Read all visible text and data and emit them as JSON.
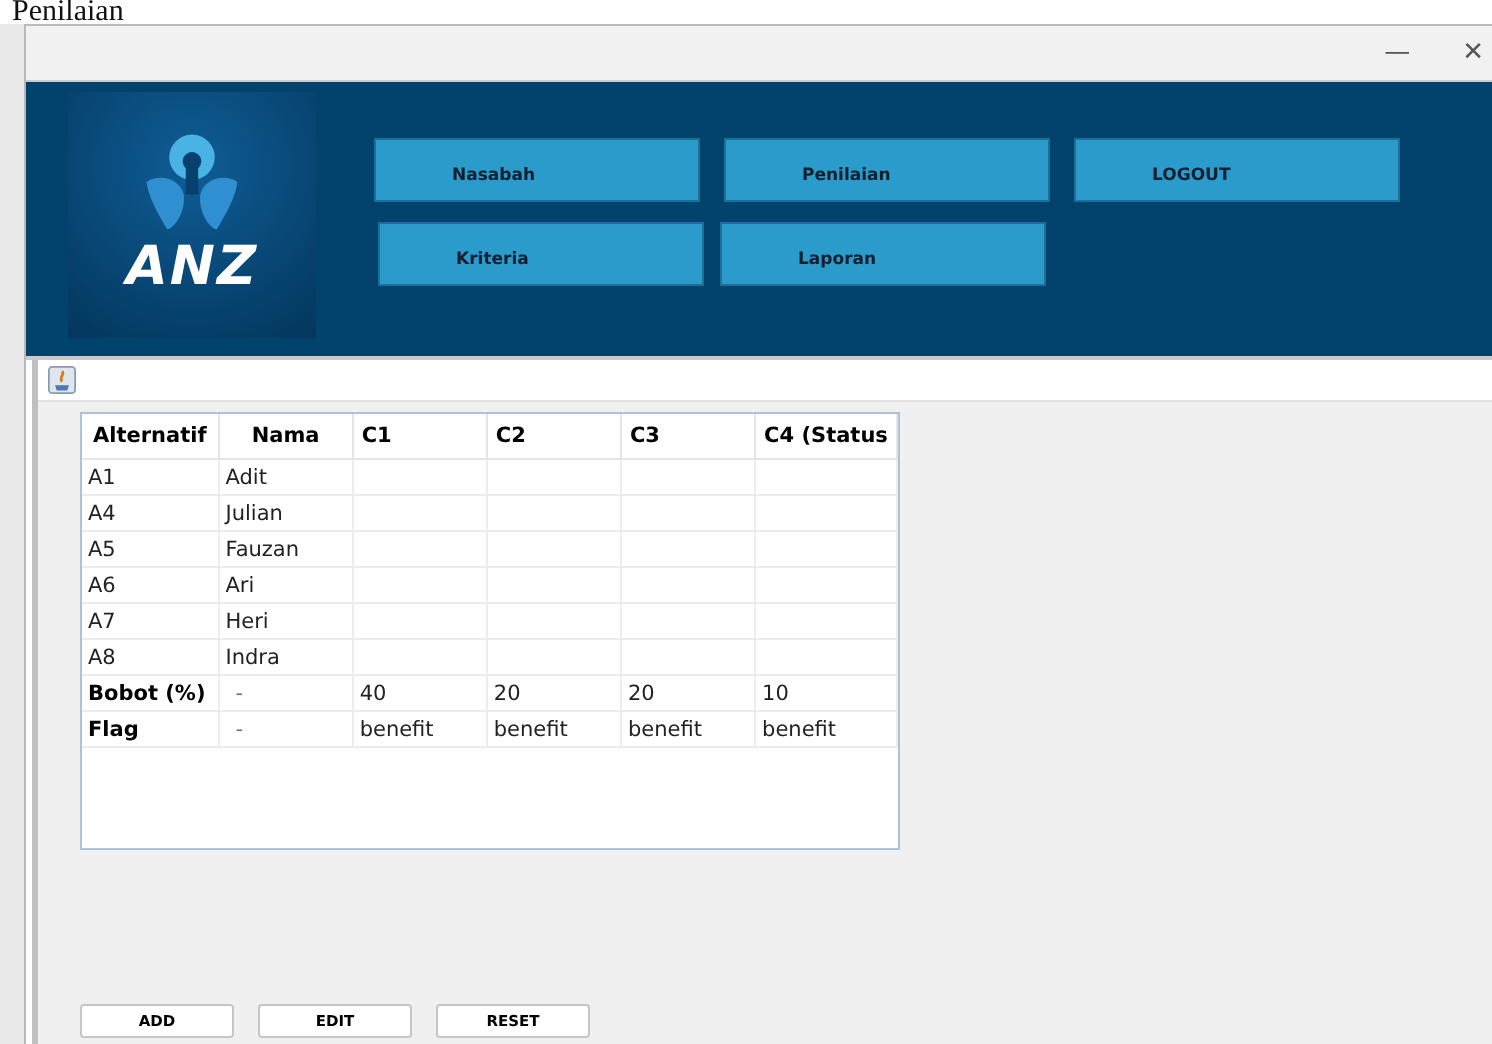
{
  "document_heading": "Penilaian",
  "window": {
    "controls": [
      "—",
      "✕"
    ]
  },
  "logo": {
    "text": "ANZ"
  },
  "menu_rows": [
    [
      "Nasabah",
      "Penilaian",
      "LOGOUT"
    ],
    [
      "Kriteria",
      "Laporan"
    ]
  ],
  "table": {
    "columns": [
      "Alternatif",
      "Nama",
      "C1",
      "C2",
      "C3",
      "C4 (Status"
    ],
    "rows": [
      {
        "kind": "alternative",
        "cells": [
          "A1",
          "Adit",
          "",
          "",
          "",
          ""
        ]
      },
      {
        "kind": "alternative",
        "cells": [
          "A4",
          "Julian",
          "",
          "",
          "",
          ""
        ]
      },
      {
        "kind": "alternative",
        "cells": [
          "A5",
          "Fauzan",
          "",
          "",
          "",
          ""
        ]
      },
      {
        "kind": "alternative",
        "cells": [
          "A6",
          "Ari",
          "",
          "",
          "",
          ""
        ]
      },
      {
        "kind": "alternative",
        "cells": [
          "A7",
          "Heri",
          "",
          "",
          "",
          ""
        ]
      },
      {
        "kind": "alternative",
        "cells": [
          "A8",
          "Indra",
          "",
          "",
          "",
          ""
        ]
      },
      {
        "kind": "summary",
        "cells": [
          "Bobot (%)",
          "-",
          "40",
          "20",
          "20",
          "10"
        ]
      },
      {
        "kind": "summary",
        "cells": [
          "Flag",
          "-",
          "benefit",
          "benefit",
          "benefit",
          "benefit"
        ]
      }
    ]
  },
  "buttons": [
    "ADD",
    "EDIT",
    "RESET"
  ]
}
